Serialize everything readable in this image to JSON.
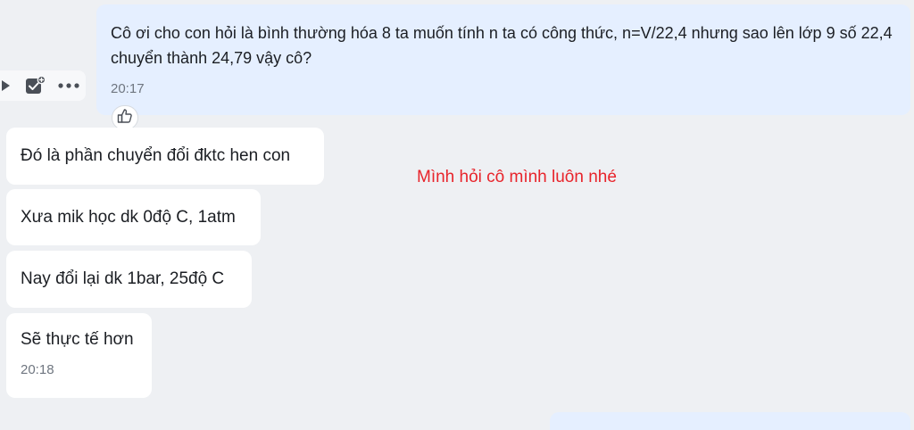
{
  "conversation": {
    "sent_message": {
      "text": "Cô ơi cho con hỏi là bình thường hóa 8 ta muốn tính n ta có công thức, n=V/22,4 nhưng sao lên lớp 9 số 22,4 chuyển thành 24,79 vậy cô?",
      "time": "20:17",
      "reaction_icon": "thumbs-up-icon"
    },
    "hover_actions": [
      {
        "icon": "forward-icon"
      },
      {
        "icon": "task-add-icon"
      },
      {
        "icon": "more-icon"
      }
    ],
    "received_messages": [
      {
        "text": "Đó là phần chuyển đổi đktc hen con"
      },
      {
        "text": "Xưa mik học dk 0độ C, 1atm"
      },
      {
        "text": "Nay đổi lại dk 1bar, 25độ C"
      },
      {
        "text": "Sẽ thực tế hơn",
        "time": "20:18"
      }
    ],
    "overlay_note": "Mình hỏi cô mình luôn nhé"
  },
  "colors": {
    "background": "#eef0f3",
    "sent_bubble": "#e5efff",
    "received_bubble": "#ffffff",
    "note_text": "#e8242b",
    "timestamp": "#6f7680"
  }
}
